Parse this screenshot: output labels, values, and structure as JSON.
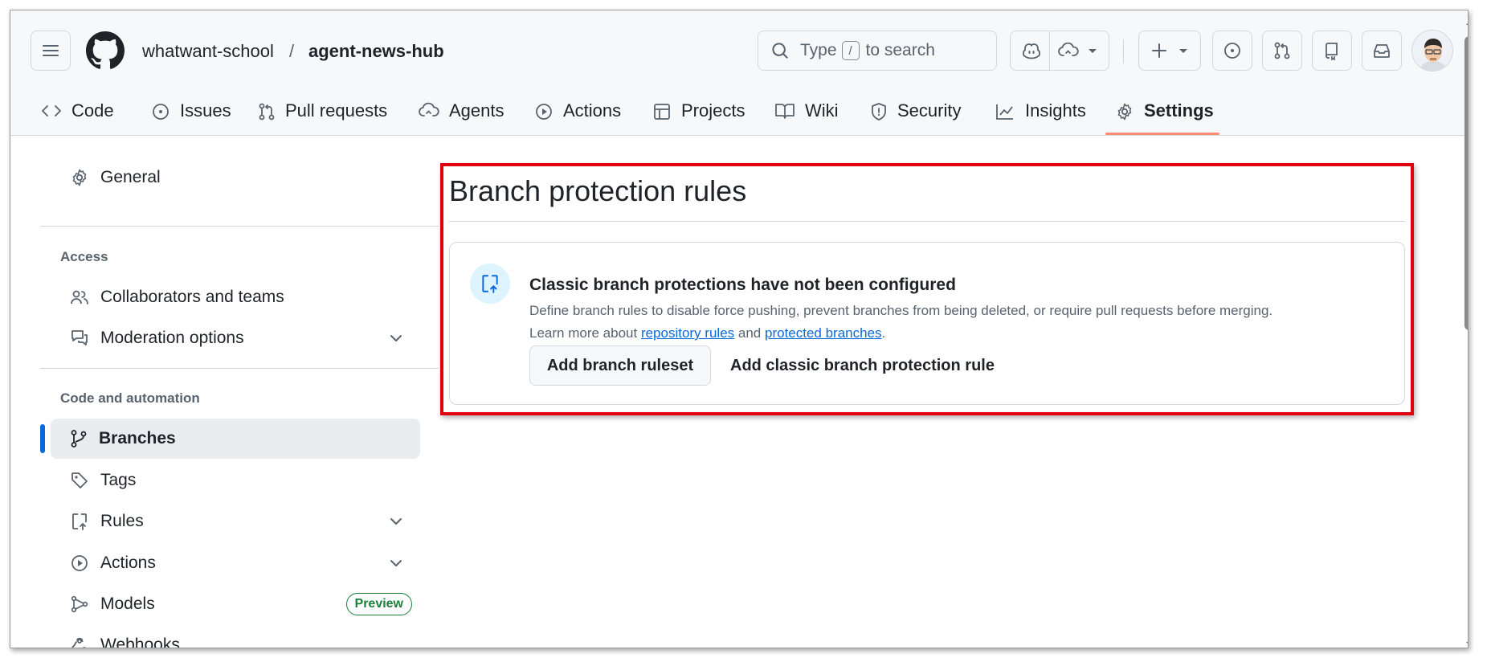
{
  "header": {
    "owner": "whatwant-school",
    "separator": "/",
    "repo": "agent-news-hub",
    "search": {
      "prefix": "Type",
      "key": "/",
      "suffix": "to search"
    }
  },
  "icons": {
    "menu": "hamburger-icon",
    "logo": "github-mark-icon",
    "search": "search-icon",
    "copilot": "copilot-icon",
    "codespaces": "cloud-icon",
    "create": "plus-icon",
    "issues": "issue-opened-icon",
    "pulls": "git-pull-request-icon",
    "repos": "repo-icon",
    "inbox": "inbox-icon"
  },
  "tabs": [
    {
      "label": "Code",
      "icon": "code-icon"
    },
    {
      "label": "Issues",
      "icon": "issue-opened-icon"
    },
    {
      "label": "Pull requests",
      "icon": "git-pull-request-icon"
    },
    {
      "label": "Agents",
      "icon": "agent-icon"
    },
    {
      "label": "Actions",
      "icon": "play-icon"
    },
    {
      "label": "Projects",
      "icon": "table-icon"
    },
    {
      "label": "Wiki",
      "icon": "book-icon"
    },
    {
      "label": "Security",
      "icon": "shield-icon"
    },
    {
      "label": "Insights",
      "icon": "graph-icon"
    },
    {
      "label": "Settings",
      "icon": "gear-icon",
      "active": true
    }
  ],
  "sidebar": {
    "general": "General",
    "access_heading": "Access",
    "collaborators": "Collaborators and teams",
    "moderation": "Moderation options",
    "code_heading": "Code and automation",
    "branches": "Branches",
    "tags": "Tags",
    "rules": "Rules",
    "actions": "Actions",
    "models": "Models",
    "models_badge": "Preview",
    "webhooks": "Webhooks"
  },
  "main": {
    "title": "Branch protection rules",
    "blankslate": {
      "heading": "Classic branch protections have not been configured",
      "description": "Define branch rules to disable force pushing, prevent branches from being deleted, or require pull requests before merging.",
      "learn_prefix": "Learn more about",
      "link1": "repository rules",
      "and": "and",
      "link2": "protected branches",
      "period": "."
    },
    "add_ruleset_button": "Add branch ruleset",
    "add_classic_button": "Add classic branch protection rule"
  },
  "colors": {
    "accent": "#0969da",
    "active_tab_underline": "#fd8c73",
    "highlight_box": "#e00010",
    "preview_badge": "#1a7f37"
  }
}
